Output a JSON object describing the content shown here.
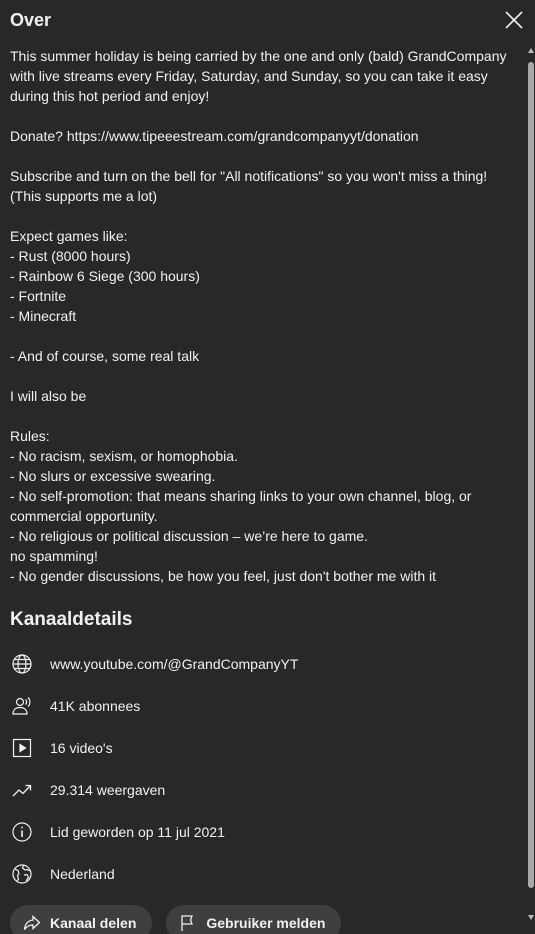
{
  "header": {
    "title": "Over"
  },
  "description": {
    "lines": [
      "This summer holiday is being carried by the one and only (bald) GrandCompany",
      "with live streams every Friday, Saturday, and Sunday, so you can take it easy",
      "during this hot period and enjoy!",
      "",
      "Donate? https://www.tipeeestream.com/grandcompanyyt/donation",
      "",
      "Subscribe and turn on the bell for \"All notifications\" so you won't miss a thing!",
      "(This supports me a lot)",
      "",
      "Expect games like:",
      "- Rust (8000 hours)",
      "- Rainbow 6 Siege (300 hours)",
      "- Fortnite",
      "- Minecraft",
      "",
      "- And of course, some real talk",
      "",
      "I will also be",
      "",
      "Rules:",
      "- No racism, sexism, or homophobia.",
      "- No slurs or excessive swearing.",
      "- No self-promotion: that means sharing links to your own channel, blog, or",
      "commercial opportunity.",
      "- No religious or political discussion – we’re here to game.",
      "no spamming!",
      "- No gender discussions, be how you feel, just don't bother me with it"
    ]
  },
  "channel_details": {
    "title": "Kanaaldetails",
    "items": [
      {
        "icon": "globe-icon",
        "text": "www.youtube.com/@GrandCompanyYT"
      },
      {
        "icon": "subscribers-icon",
        "text": "41K abonnees"
      },
      {
        "icon": "video-play-icon",
        "text": "16 video's"
      },
      {
        "icon": "trending-up-icon",
        "text": "29.314 weergaven"
      },
      {
        "icon": "info-icon",
        "text": "Lid geworden op 11 jul 2021"
      },
      {
        "icon": "earth-icon",
        "text": "Nederland"
      }
    ]
  },
  "actions": {
    "share_label": "Kanaal delen",
    "report_label": "Gebruiker melden"
  },
  "colors": {
    "background": "#282828",
    "text": "#f1f1f1",
    "pill_background": "#3f3f3f"
  }
}
